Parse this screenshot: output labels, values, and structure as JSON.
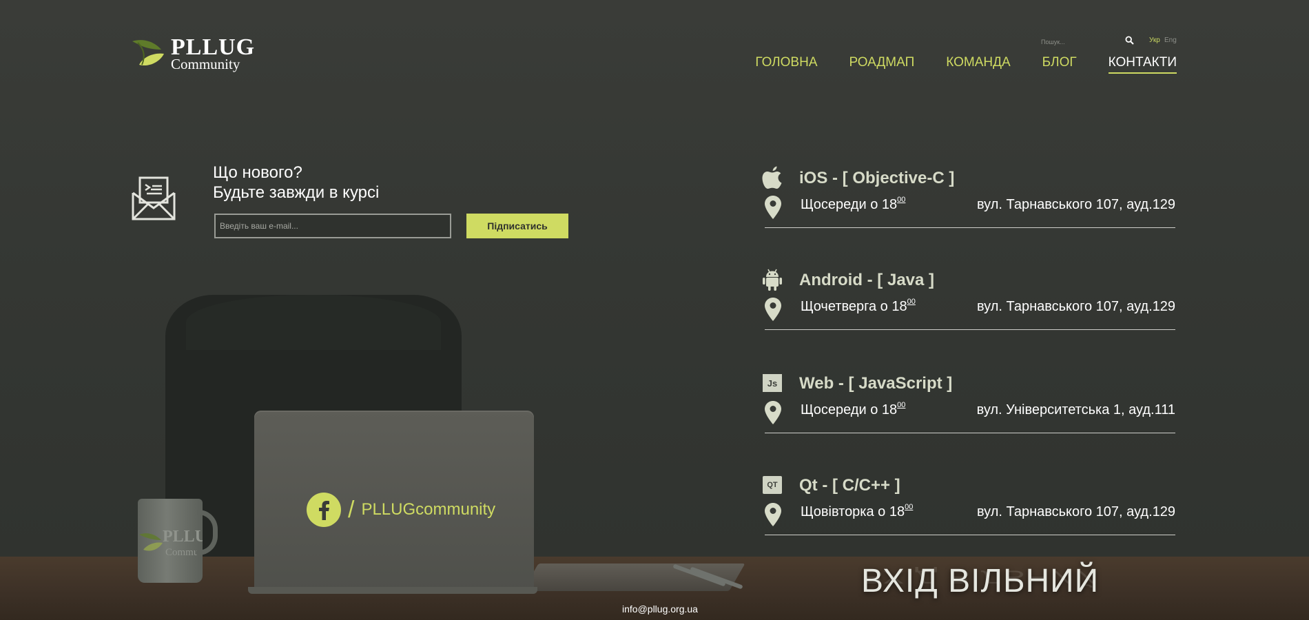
{
  "header": {
    "logo": {
      "title": "PLLUG",
      "subtitle": "Community"
    },
    "search": {
      "placeholder": "Пошук...",
      "icon": "search-icon"
    },
    "languages": [
      {
        "label": "Укр",
        "active": true
      },
      {
        "label": "Eng",
        "active": false
      }
    ],
    "nav": [
      {
        "label": "ГОЛОВНА",
        "active": false
      },
      {
        "label": "РОАДМАП",
        "active": false
      },
      {
        "label": "КОМАНДА",
        "active": false
      },
      {
        "label": "БЛОГ",
        "active": false
      },
      {
        "label": "КОНТАКТИ",
        "active": true
      }
    ]
  },
  "newsletter": {
    "icon": "envelope-icon",
    "title_line1": "Що нового?",
    "title_line2": "Будьте завжди в курсі",
    "email_placeholder": "Введіть ваш e-mail...",
    "subscribe_label": "Підписатись"
  },
  "social": {
    "icon": "facebook-icon",
    "separator": "/",
    "label": "PLLUGcommunity"
  },
  "mug": {
    "logo_text": "PLLU",
    "logo_sub": "Commu"
  },
  "courses": [
    {
      "icon": "apple-icon",
      "title": "iOS - [ Objective-C ]",
      "time": "Щосереди о 18",
      "minutes": "00",
      "address": "вул. Тарнавського 107, ауд.129"
    },
    {
      "icon": "android-icon",
      "title": "Android - [ Java ]",
      "time": "Щочетверга о 18",
      "minutes": "00",
      "address": "вул. Тарнавського 107, ауд.129"
    },
    {
      "icon": "javascript-icon",
      "badge": "Js",
      "title": "Web - [ JavaScript ]",
      "time": "Щосереди о 18",
      "minutes": "00",
      "address": "вул. Університетська 1, ауд.111"
    },
    {
      "icon": "qt-icon",
      "badge": "QT",
      "title": "Qt - [ C/C++ ]",
      "time": "Щовівторка о 18",
      "minutes": "00",
      "address": "вул. Тарнавського 107, ауд.129"
    }
  ],
  "free_entry": "ВХІД ВІЛЬНИЙ",
  "footer": {
    "email": "info@pllug.org.ua"
  },
  "colors": {
    "accent": "#cfdb62",
    "background": "#363935",
    "text": "#ffffff"
  }
}
